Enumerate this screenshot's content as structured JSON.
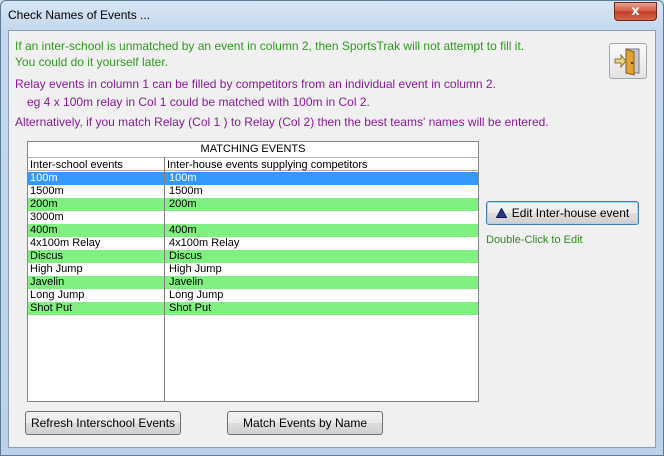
{
  "window": {
    "title": "Check Names of Events ...",
    "close_label": "x"
  },
  "messages": {
    "line1": "If an inter-school is unmatched by an event in column 2, then SportsTrak will not attempt to fill it.",
    "line2": "You could do it yourself later.",
    "line3": "Relay events in column 1 can be filled by competitors from an individual event in column 2.",
    "line4": "eg 4 x 100m relay in Col 1 could be matched with 100m in Col 2.",
    "line5": "Alternatively, if you match Relay (Col 1 ) to Relay (Col 2) then the best teams' names will be entered."
  },
  "exit_button": {
    "icon": "exit-door-icon"
  },
  "grid": {
    "title": "MATCHING EVENTS",
    "col1_header": "Inter-school events",
    "col2_header": "Inter-house events supplying competitors",
    "rows": [
      {
        "interschool": "100m",
        "interhouse": "100m",
        "style": "selected"
      },
      {
        "interschool": "1500m",
        "interhouse": "1500m",
        "style": "plain"
      },
      {
        "interschool": "200m",
        "interhouse": "200m",
        "style": "green"
      },
      {
        "interschool": "3000m",
        "interhouse": "",
        "style": "plain"
      },
      {
        "interschool": "400m",
        "interhouse": "400m",
        "style": "green"
      },
      {
        "interschool": "4x100m Relay",
        "interhouse": "4x100m Relay",
        "style": "plain"
      },
      {
        "interschool": "Discus",
        "interhouse": "Discus",
        "style": "green"
      },
      {
        "interschool": "High Jump",
        "interhouse": "High Jump",
        "style": "plain"
      },
      {
        "interschool": "Javelin",
        "interhouse": "Javelin",
        "style": "green"
      },
      {
        "interschool": "Long Jump",
        "interhouse": "Long Jump",
        "style": "plain"
      },
      {
        "interschool": "Shot Put",
        "interhouse": "Shot Put",
        "style": "green"
      }
    ]
  },
  "buttons": {
    "edit_label": "Edit Inter-house event",
    "refresh_label": "Refresh Interschool Events",
    "match_label": "Match Events by Name"
  },
  "hint": "Double-Click to Edit",
  "colors": {
    "green_text": "#2f9a1f",
    "purple_text": "#8b1b9a",
    "row_green": "#80f080",
    "row_selected": "#3399ff"
  }
}
